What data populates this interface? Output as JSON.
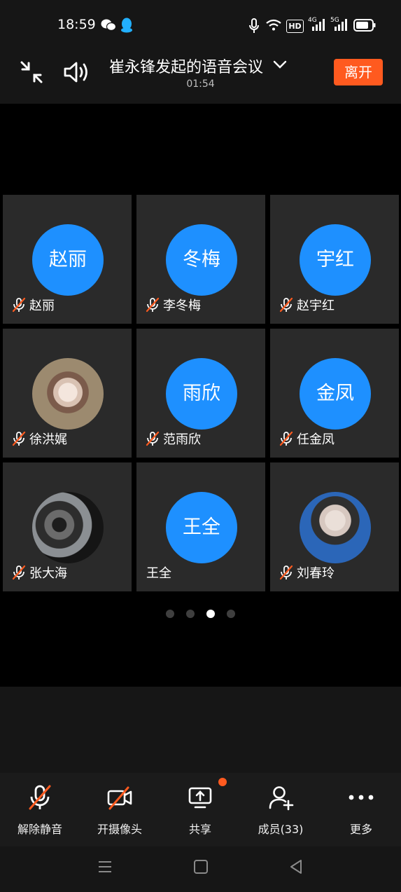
{
  "status_bar": {
    "time": "18:59",
    "icons": [
      "wechat-icon",
      "qq-icon",
      "mic-icon",
      "wifi-icon",
      "hd-icon",
      "4g-signal-icon",
      "5g-signal-icon",
      "battery-icon"
    ],
    "network": {
      "hd": "HD",
      "g4": "4G",
      "g5": "5G"
    }
  },
  "header": {
    "title": "崔永锋发起的语音会议",
    "timer": "01:54",
    "leave_label": "离开"
  },
  "participants": [
    {
      "avatar_text": "赵丽",
      "name": "赵丽",
      "muted": true,
      "avatar": "text"
    },
    {
      "avatar_text": "冬梅",
      "name": "李冬梅",
      "muted": true,
      "avatar": "text"
    },
    {
      "avatar_text": "宇红",
      "name": "赵宇红",
      "muted": true,
      "avatar": "text"
    },
    {
      "avatar_text": "",
      "name": "徐洪娓",
      "muted": true,
      "avatar": "photo"
    },
    {
      "avatar_text": "雨欣",
      "name": "范雨欣",
      "muted": true,
      "avatar": "text"
    },
    {
      "avatar_text": "金凤",
      "name": "任金凤",
      "muted": true,
      "avatar": "text"
    },
    {
      "avatar_text": "",
      "name": "张大海",
      "muted": true,
      "avatar": "photo"
    },
    {
      "avatar_text": "王全",
      "name": "王全",
      "muted": false,
      "avatar": "text"
    },
    {
      "avatar_text": "",
      "name": "刘春玲",
      "muted": true,
      "avatar": "photo"
    }
  ],
  "pager": {
    "count": 4,
    "active_index": 2
  },
  "toolbar": {
    "unmute_label": "解除静音",
    "camera_label": "开摄像头",
    "share_label": "共享",
    "members_label": "成员(33)",
    "more_label": "更多"
  },
  "colors": {
    "accent": "#1e90ff",
    "leave": "#ff5a1f",
    "muted_slash": "#ff5a1f",
    "badge": "#ff5a1f"
  }
}
